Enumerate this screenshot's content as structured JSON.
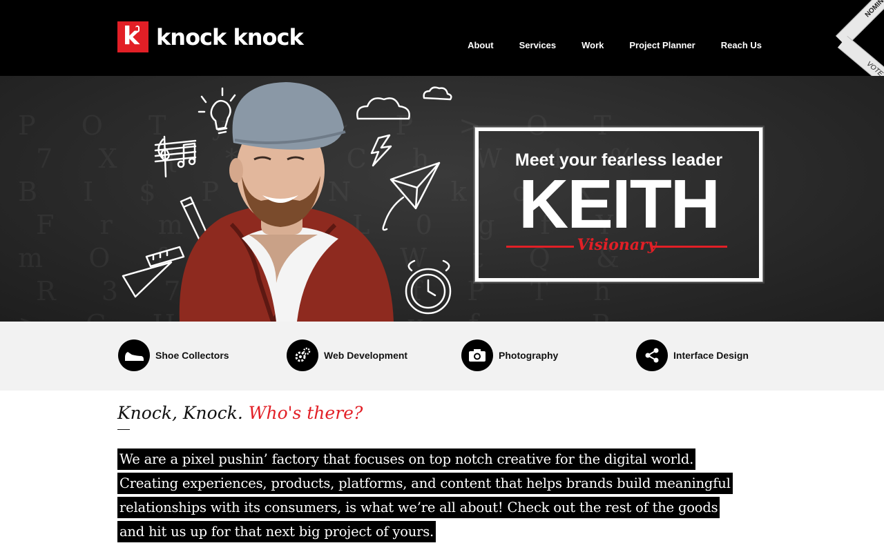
{
  "brand": {
    "logo_letter": "k",
    "name": "knock knock"
  },
  "nav": {
    "items": [
      "About",
      "Services",
      "Work",
      "Project Planner",
      "Reach Us"
    ]
  },
  "ribbon": {
    "line1": "NOMINEE",
    "line2": "VOTE for us"
  },
  "hero": {
    "tagline": "Meet your fearless leader",
    "name": "KEITH",
    "role": "Visionary"
  },
  "services": [
    {
      "label": "Shoe Collectors",
      "icon": "shoe-icon"
    },
    {
      "label": "Web Development",
      "icon": "gears-icon"
    },
    {
      "label": "Photography",
      "icon": "camera-icon"
    },
    {
      "label": "Interface Design",
      "icon": "share-icon"
    }
  ],
  "intro": {
    "title_part1": "Knock, Knock.",
    "title_part2": "Who's there?",
    "body": "We are a pixel pushin’ factory that focuses on top notch creative for the digital world. Creating experiences, products, platforms, and content that helps brands build meaningful relationships with its consumers, is what we’re all about! Check out the rest of the goods and hit us up for that next big project of yours."
  },
  "colors": {
    "accent": "#e21f26",
    "header_bg": "#000000",
    "services_bg": "#f2f2f2"
  }
}
